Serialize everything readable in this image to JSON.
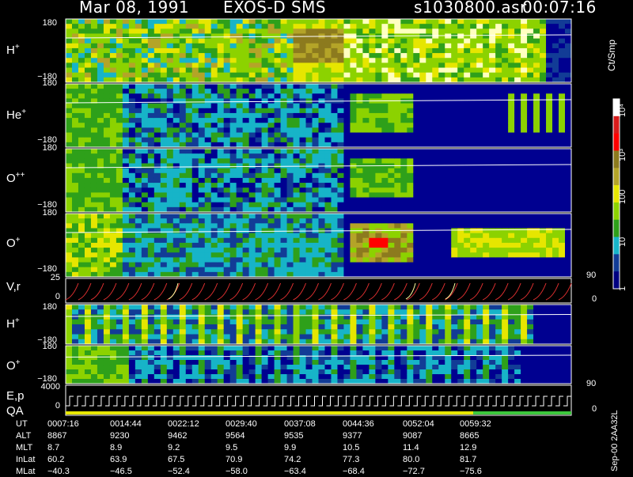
{
  "header": {
    "date": "Mar 08, 1991",
    "instrument": "EXOS-D SMS",
    "file": "s1030800.asr",
    "time": "00:07:16"
  },
  "panels": [
    {
      "label": "H",
      "charge": "+",
      "top": "180",
      "bottom": "−180"
    },
    {
      "label": "He",
      "charge": "+",
      "top": "180",
      "bottom": "−180"
    },
    {
      "label": "O",
      "charge": "++",
      "top": "180",
      "bottom": "−180"
    },
    {
      "label": "O",
      "charge": "+",
      "top": "180",
      "bottom": "−180"
    },
    {
      "label": "V,r",
      "top": "25",
      "bottom": "0",
      "right": "90",
      "right_bottom": "0"
    },
    {
      "label": "H",
      "charge": "+",
      "top": "180",
      "bottom": "−180"
    },
    {
      "label": "O",
      "charge": "+",
      "top": "180",
      "bottom": "−180",
      "right": "90"
    },
    {
      "label": "E,p",
      "top": "4000",
      "label2": "QA",
      "bottom": "0",
      "right": "0"
    }
  ],
  "colorbar": {
    "unit": "Ct/Smp",
    "ticks": [
      "10⁴",
      "10³",
      "100",
      "10",
      "1"
    ],
    "colors": [
      "#ffffff",
      "#d81c1c",
      "#ff0000",
      "#8c7a1e",
      "#b4a428",
      "#e6e600",
      "#8cd200",
      "#2ea01a",
      "#17b4c8",
      "#123c96",
      "#000080"
    ]
  },
  "footer": {
    "rows": [
      {
        "name": "UT",
        "values": [
          "0007:16",
          "0014:44",
          "0022:12",
          "0029:40",
          "0037:08",
          "0044:36",
          "0052:04",
          "0059:32"
        ]
      },
      {
        "name": "ALT",
        "values": [
          "8867",
          "9230",
          "9462",
          "9564",
          "9535",
          "9377",
          "9087",
          "8665"
        ]
      },
      {
        "name": "MLT",
        "values": [
          "8.7",
          "8.9",
          "9.2",
          "9.5",
          "9.9",
          "10.5",
          "11.4",
          "12.9"
        ]
      },
      {
        "name": "InLat",
        "values": [
          "60.2",
          "63.9",
          "67.5",
          "70.9",
          "74.2",
          "77.3",
          "80.0",
          "81.7"
        ]
      },
      {
        "name": "MLat",
        "values": [
          "−40.3",
          "−46.5",
          "−52.4",
          "−58.0",
          "−63.4",
          "−68.4",
          "−72.7",
          "−75.6"
        ]
      }
    ],
    "stamp": "Sep-00 2AA32L"
  },
  "chart_data": {
    "type": "heatmap",
    "title": "Mar 08, 1991 EXOS-D SMS",
    "panels": [
      "H+",
      "He+",
      "O++",
      "O+",
      "V,r",
      "H+",
      "O+",
      "E,p / QA"
    ],
    "x": [
      "0007:16",
      "0014:44",
      "0022:12",
      "0029:40",
      "0037:08",
      "0044:36",
      "0052:04",
      "0059:32"
    ],
    "pitch_angle_range": [
      -180,
      180
    ],
    "colorbar_range": [
      1,
      10000
    ],
    "colorbar_scale": "log",
    "colorbar_label": "Ct/Smp"
  }
}
